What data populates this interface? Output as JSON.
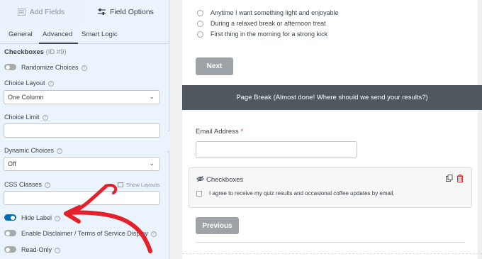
{
  "sidebar": {
    "tabs": {
      "add_fields": "Add Fields",
      "field_options": "Field Options"
    },
    "subtabs": {
      "general": "General",
      "advanced": "Advanced",
      "smart_logic": "Smart Logic"
    },
    "field": {
      "name": "Checkboxes",
      "id": "(ID #9)"
    },
    "randomize": {
      "label": "Randomize Choices",
      "on": false
    },
    "choice_layout": {
      "label": "Choice Layout",
      "value": "One Column"
    },
    "choice_limit": {
      "label": "Choice Limit",
      "value": ""
    },
    "dynamic_choices": {
      "label": "Dynamic Choices",
      "value": "Off"
    },
    "css_classes": {
      "label": "CSS Classes",
      "show_layouts": "Show Layouts",
      "value": ""
    },
    "hide_label": {
      "label": "Hide Label",
      "on": true
    },
    "disclaimer": {
      "label": "Enable Disclaimer / Terms of Service Display",
      "on": false
    },
    "read_only": {
      "label": "Read-Only",
      "on": false
    }
  },
  "preview": {
    "choices": [
      "Anytime I want something light and enjoyable",
      "During a relaxed break or afternoon treat",
      "First thing in the morning for a strong kick"
    ],
    "next_button": "Next",
    "page_break": "Page Break (Almost done! Where should we send your results?)",
    "email_label": "Email Address",
    "required_mark": "*",
    "checkbox_field_title": "Checkboxes",
    "checkbox_item": "I agree to receive my quiz results and occasional coffee updates by email.",
    "previous_button": "Previous"
  },
  "colors": {
    "accent": "#036aab",
    "arrow": "#e6202a",
    "delete": "#d63638",
    "page_break_bg": "#50575e"
  }
}
